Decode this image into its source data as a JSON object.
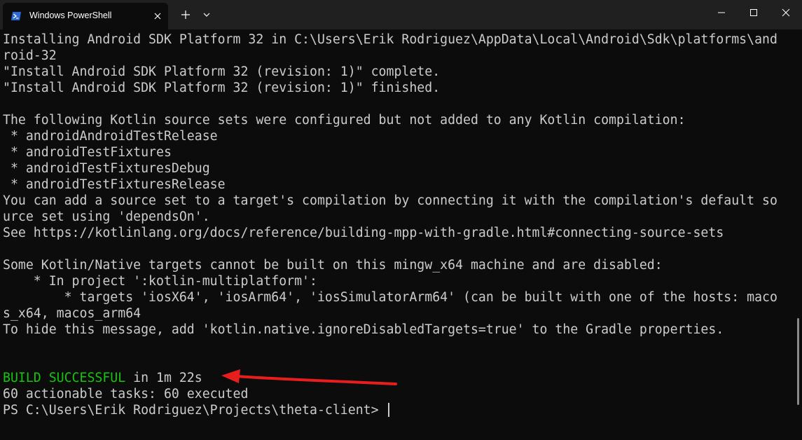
{
  "window": {
    "tab_title": "Windows PowerShell",
    "controls": {
      "new_tab": "+",
      "minimize": "minimize",
      "maximize": "maximize",
      "close": "close"
    }
  },
  "terminal": {
    "lines": [
      "Installing Android SDK Platform 32 in C:\\Users\\Erik Rodriguez\\AppData\\Local\\Android\\Sdk\\platforms\\and",
      "roid-32",
      "\"Install Android SDK Platform 32 (revision: 1)\" complete.",
      "\"Install Android SDK Platform 32 (revision: 1)\" finished.",
      "",
      "The following Kotlin source sets were configured but not added to any Kotlin compilation:",
      " * androidAndroidTestRelease",
      " * androidTestFixtures",
      " * androidTestFixturesDebug",
      " * androidTestFixturesRelease",
      "You can add a source set to a target's compilation by connecting it with the compilation's default so",
      "urce set using 'dependsOn'.",
      "See https://kotlinlang.org/docs/reference/building-mpp-with-gradle.html#connecting-source-sets",
      "",
      "Some Kotlin/Native targets cannot be built on this mingw_x64 machine and are disabled:",
      "    * In project ':kotlin-multiplatform':",
      "        * targets 'iosX64', 'iosArm64', 'iosSimulatorArm64' (can be built with one of the hosts: maco",
      "s_x64, macos_arm64",
      "To hide this message, add 'kotlin.native.ignoreDisabledTargets=true' to the Gradle properties.",
      "",
      ""
    ],
    "build_status": "BUILD SUCCESSFUL",
    "build_time": " in 1m 22s",
    "tasks_line": "60 actionable tasks: 60 executed",
    "prompt": "PS C:\\Users\\Erik Rodriguez\\Projects\\theta-client> "
  },
  "colors": {
    "background": "#0c0c0c",
    "titlebar": "#202020",
    "text": "#cccccc",
    "success_green": "#16c60c",
    "annotation_arrow": "#e81e1e"
  },
  "icons": {
    "tab_icon": "powershell-icon",
    "tab_close": "close-icon",
    "new_tab": "plus-icon",
    "dropdown": "chevron-down-icon"
  }
}
